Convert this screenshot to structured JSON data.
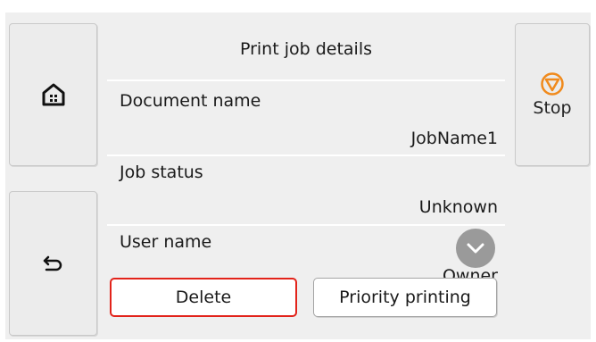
{
  "header": {
    "title": "Print job details"
  },
  "nav": {
    "home_icon": "home-icon",
    "back_icon": "back-arrow-icon",
    "stop_icon": "stop-icon",
    "stop_label": "Stop"
  },
  "details": [
    {
      "label": "Document name",
      "value": "JobName1"
    },
    {
      "label": "Job status",
      "value": "Unknown"
    },
    {
      "label": "User name",
      "value": "Owner"
    }
  ],
  "actions": {
    "delete_label": "Delete",
    "priority_label": "Priority printing"
  },
  "colors": {
    "accent_stop": "#f08a1c",
    "delete_border": "#e2231a",
    "background": "#efefef"
  }
}
